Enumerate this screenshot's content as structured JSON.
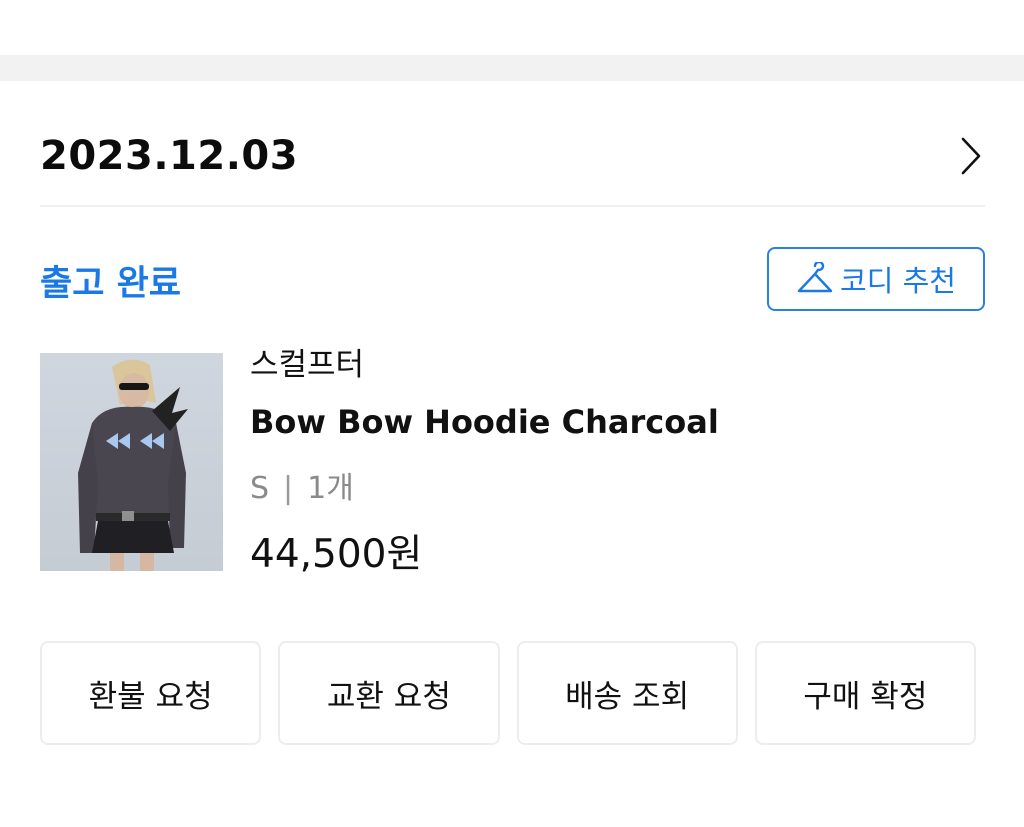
{
  "order": {
    "date": "2023.12.03",
    "status": "출고 완료",
    "outfit_button_label": "코디 추천"
  },
  "product": {
    "brand": "스컬프터",
    "name": "Bow Bow Hoodie Charcoal",
    "size": "S",
    "separator": "|",
    "quantity": "1개",
    "price": "44,500원"
  },
  "actions": [
    {
      "label": "환불 요청"
    },
    {
      "label": "교환 요청"
    },
    {
      "label": "배송 조회"
    },
    {
      "label": "구매 확정"
    }
  ],
  "colors": {
    "accent": "#1a79e5",
    "band": "#f2f2f2",
    "divider": "#efefef",
    "muted_text": "#8a8a8a"
  },
  "icons": {
    "header_arrow": "chevron-right-icon",
    "outfit": "hanger-icon"
  }
}
